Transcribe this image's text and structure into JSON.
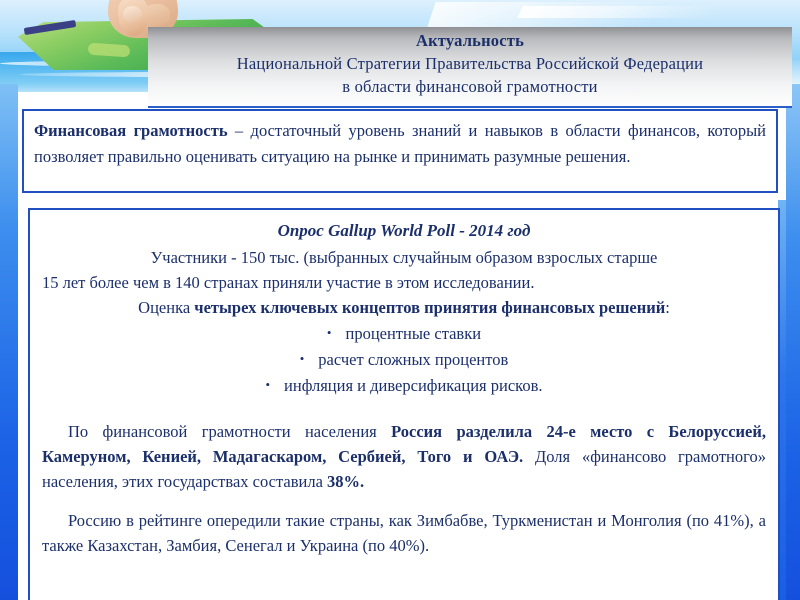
{
  "header": {
    "title_line1": "Актуальность",
    "title_line2": "Национальной Стратегии Правительства Российской Федерации",
    "title_line3": "в области финансовой грамотности"
  },
  "definition": {
    "term": "Финансовая грамотность",
    "body": " – достаточный уровень знаний и навыков в области финансов, который позволяет правильно оценивать ситуацию на рынке и принимать разумные решения."
  },
  "main": {
    "poll_title": "Опрос Gallup World Poll - 2014 год",
    "participants_line1": "Участники - 150 тыс. (выбранных случайным образом взрослых старше",
    "participants_line2": "15 лет более чем в 140 странах приняли участие в этом исследовании.",
    "concepts_prefix": "Оценка ",
    "concepts_bold": "четырех ключевых концептов принятия финансовых решений",
    "concepts_suffix": ":",
    "bullet_marker": "•",
    "bullets": [
      "процентные ставки",
      "расчет сложных процентов",
      "инфляция и диверсификация рисков."
    ],
    "ranking_p1_a": "По финансовой грамотности населения ",
    "ranking_p1_b": "Россия разделила 24-е место с Белоруссией, Камеруном, Кенией, Мадагаскаром, Сербией, Того и ОАЭ.",
    "ranking_p1_c": " Доля «финансово грамотного» населения, этих государствах составила ",
    "ranking_p1_d": "38%.",
    "ranking_p2": "Россию в рейтинге опередили такие страны, как Зимбабве, Туркменистан и Монголия (по 41%), а также Казахстан, Замбия, Сенегал и Украина (по 40%)."
  },
  "colors": {
    "text_navy": "#1b2f6b",
    "border_blue": "#1f4fc0",
    "rail_blue": "#1b62e6"
  }
}
